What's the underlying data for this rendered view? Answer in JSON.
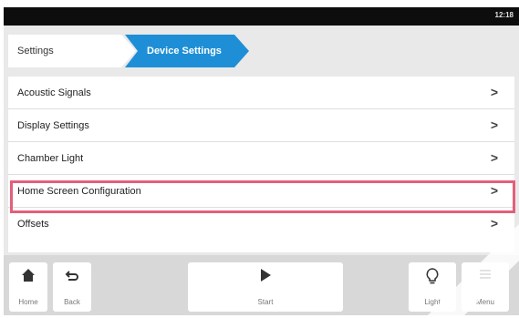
{
  "statusbar": {
    "time": "12:18"
  },
  "breadcrumb": {
    "root": "Settings",
    "current": "Device Settings"
  },
  "list": {
    "items": [
      {
        "label": "Acoustic Signals",
        "chevron": ">"
      },
      {
        "label": "Display Settings",
        "chevron": ">"
      },
      {
        "label": "Chamber Light",
        "chevron": ">"
      },
      {
        "label": "Home Screen Configuration",
        "chevron": ">",
        "highlighted": true
      },
      {
        "label": "Offsets",
        "chevron": ">"
      }
    ]
  },
  "navbar": {
    "home": {
      "label": "Home",
      "icon": "home-icon"
    },
    "back": {
      "label": "Back",
      "icon": "back-arrow-icon"
    },
    "start": {
      "label": "Start",
      "icon": "play-icon"
    },
    "light": {
      "label": "Light",
      "icon": "lightbulb-icon"
    },
    "menu": {
      "label": "Menu",
      "icon": "hamburger-icon"
    }
  },
  "colors": {
    "accent": "#1e8fd6",
    "highlight": "#e2607a",
    "statusbar": "#0d0d0d",
    "background": "#e9e9e9"
  }
}
